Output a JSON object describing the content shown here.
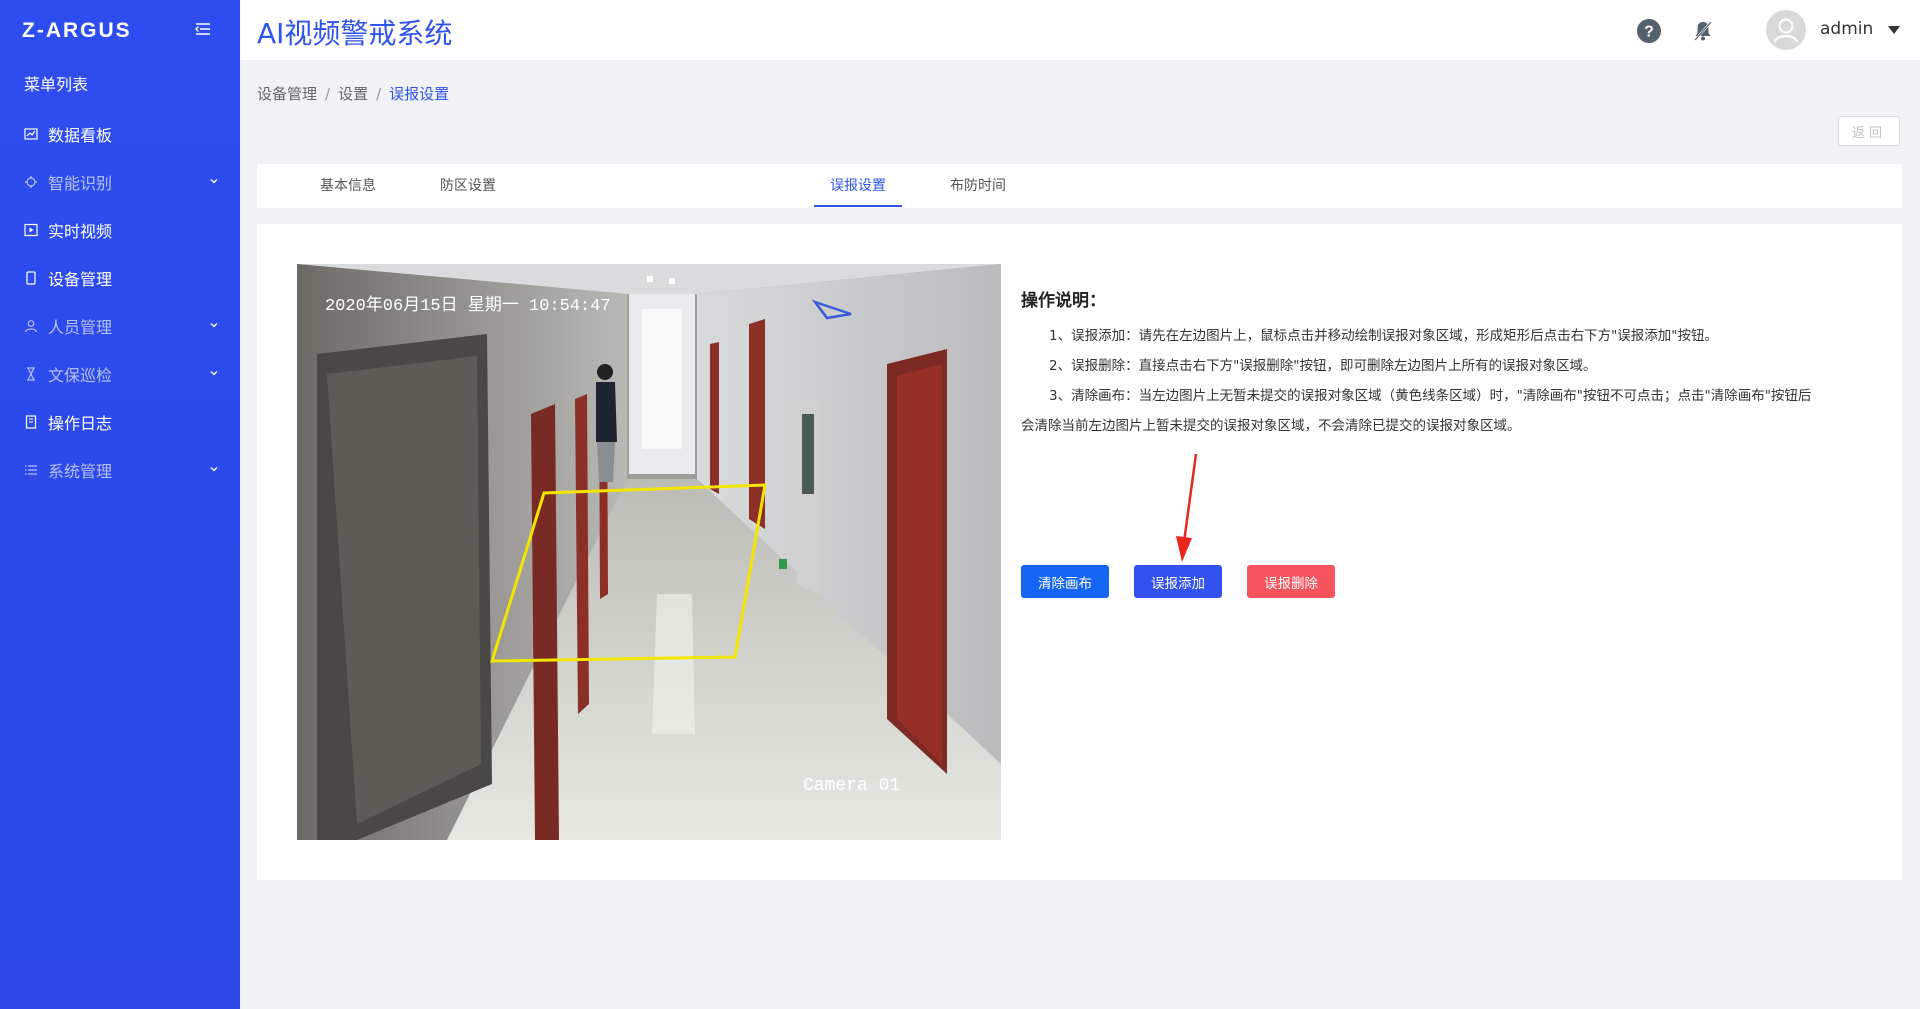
{
  "sidebar": {
    "logo": "Z-ARGUS",
    "menu_title": "菜单列表",
    "items": [
      {
        "label": "数据看板",
        "icon": "chart-icon"
      },
      {
        "label": "智能识别",
        "icon": "smart-recognition-icon"
      },
      {
        "label": "实时视频",
        "icon": "video-play-icon"
      },
      {
        "label": "设备管理",
        "icon": "device-icon"
      },
      {
        "label": "人员管理",
        "icon": "user-icon"
      },
      {
        "label": "文保巡检",
        "icon": "patrol-icon"
      },
      {
        "label": "操作日志",
        "icon": "log-icon"
      },
      {
        "label": "系统管理",
        "icon": "list-icon"
      }
    ]
  },
  "header": {
    "title": "AI视频警戒系统",
    "username": "admin"
  },
  "breadcrumb": {
    "level1": "设备管理",
    "level2": "设置",
    "current": "误报设置",
    "separator": "/"
  },
  "back_button": "返回",
  "tabs": [
    {
      "label": "基本信息",
      "active": false
    },
    {
      "label": "防区设置",
      "active": false
    },
    {
      "label": "误报设置",
      "active": true
    },
    {
      "label": "布防时间",
      "active": false
    }
  ],
  "camera": {
    "timestamp": "2020年06月15日 星期一 10:54:47",
    "label": "Camera 01"
  },
  "instructions": {
    "title": "操作说明：",
    "line1": "1、误报添加：请先在左边图片上，鼠标点击并移动绘制误报对象区域，形成矩形后点击右下方\"误报添加\"按钮。",
    "line2": "2、误报删除：直接点击右下方\"误报删除\"按钮，即可删除左边图片上所有的误报对象区域。",
    "line3": "3、清除画布：当左边图片上无暂未提交的误报对象区域（黄色线条区域）时，\"清除画布\"按钮不可点击；点击\"清除画布\"按钮后",
    "line4": "会清除当前左边图片上暂未提交的误报对象区域，不会清除已提交的误报对象区域。"
  },
  "buttons": {
    "clear": "清除画布",
    "add": "误报添加",
    "delete": "误报删除"
  },
  "colors": {
    "primary": "#2f54eb",
    "sidebar": "#2e4df0",
    "danger": "#f5535e",
    "draw_region": "#f2e600"
  }
}
